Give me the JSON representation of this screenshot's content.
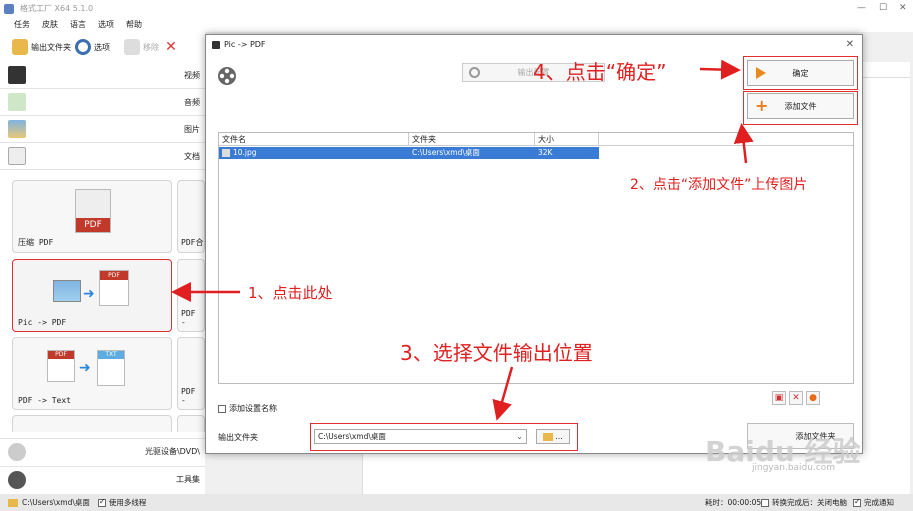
{
  "window": {
    "title": "格式工厂 X64 5.1.0"
  },
  "menu": [
    "任务",
    "皮肤",
    "语言",
    "选项",
    "帮助"
  ],
  "toolbar": {
    "output_folder": "输出文件夹",
    "options": "选项",
    "remove": "移除"
  },
  "sidebar": {
    "categories": [
      "视频",
      "音频",
      "图片",
      "文档"
    ],
    "tiles": [
      "压缩 PDF",
      "PDF合",
      "Pic -> PDF",
      "PDF -",
      "PDF -> Text",
      "PDF -"
    ],
    "tile_badges": {
      "pdf": "PDF",
      "txt": "TXT"
    },
    "bottom": [
      "光驱设备\\DVD\\",
      "工具集"
    ]
  },
  "dialog": {
    "title": "Pic -> PDF",
    "options_label": "输出配置",
    "ok_label": "确定",
    "add_file_label": "添加文件",
    "columns": [
      "文件名",
      "文件夹",
      "大小"
    ],
    "rows": [
      {
        "name": "10.jpg",
        "folder": "C:\\Users\\xmd\\桌面",
        "size": "32K"
      }
    ],
    "add_setting_label": "添加设置名称",
    "output_folder_label": "输出文件夹",
    "output_folder_value": "C:\\Users\\xmd\\桌面",
    "browse_label": "...",
    "add_folder_label": "添加文件夹"
  },
  "statusbar": {
    "path": "C:\\Users\\xmd\\桌面",
    "multithread": "使用多线程",
    "elapsed": "耗时：00:00:05",
    "shutdown": "转换完成后：关闭电脑",
    "notify": "完成通知"
  },
  "annotations": {
    "step1": "1、点击此处",
    "step2": "2、点击“添加文件”上传图片",
    "step3": "3、选择文件输出位置",
    "step4": "4、点击“确定”"
  },
  "watermark": {
    "brand": "Baidu 经验",
    "url": "jingyan.baidu.com"
  },
  "colors": {
    "annotation": "#e02020",
    "selection": "#3a7bd5",
    "accent": "#e88a1c"
  }
}
